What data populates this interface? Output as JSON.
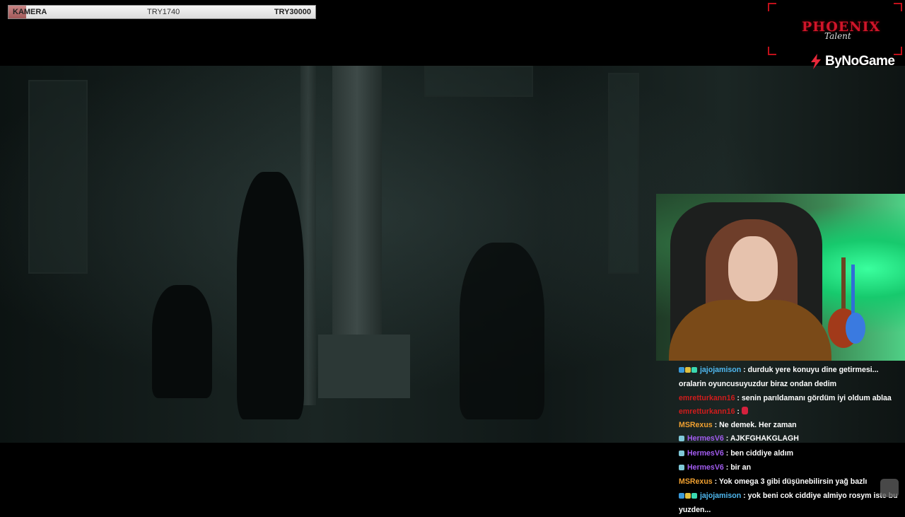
{
  "goal": {
    "label": "KAMERA",
    "current": "TRY1740",
    "target": "TRY30000",
    "progress": 0.058,
    "fill_color": "#b06a6a"
  },
  "logos": {
    "brand_main": "PHOENIX",
    "brand_sub": "Talent",
    "sponsor": "ByNoGame",
    "brand_color": "#d0152a"
  },
  "chat": {
    "messages": [
      {
        "badges": [
          "#3a9ad9",
          "#e0c040",
          "#3ad9b0"
        ],
        "user": "jajojamison",
        "user_color": "#4fb8f0",
        "text": "durduk yere konuyu dine getirmesi... oralarin oyuncusuyuzdur biraz ondan dedim"
      },
      {
        "badges": [],
        "user": "emretturkann16",
        "user_color": "#d01c1c",
        "text": "senin parıldamanı gördüm iyi oldum ablaa"
      },
      {
        "badges": [],
        "user": "emretturkann16",
        "user_color": "#d01c1c",
        "text": "",
        "emote": true
      },
      {
        "badges": [],
        "user": "MSRexus",
        "user_color": "#f0a030",
        "text": "Ne demek. Her zaman"
      },
      {
        "badges": [
          "#7fc8d8"
        ],
        "user": "HermesV6",
        "user_color": "#a25cf0",
        "text": "AJKFGHAKGLAGH"
      },
      {
        "badges": [
          "#7fc8d8"
        ],
        "user": "HermesV6",
        "user_color": "#a25cf0",
        "text": "ben ciddiye aldım"
      },
      {
        "badges": [
          "#7fc8d8"
        ],
        "user": "HermesV6",
        "user_color": "#a25cf0",
        "text": "bir an"
      },
      {
        "badges": [],
        "user": "MSRexus",
        "user_color": "#f0a030",
        "text": "Yok omega 3 gibi düşünebilirsin yağ bazlı"
      },
      {
        "badges": [
          "#3a9ad9",
          "#e0c040",
          "#3ad9b0"
        ],
        "user": "jajojamison",
        "user_color": "#4fb8f0",
        "text": "yok beni cok ciddiye almiyo rosym iste bu yuzden..."
      }
    ]
  }
}
